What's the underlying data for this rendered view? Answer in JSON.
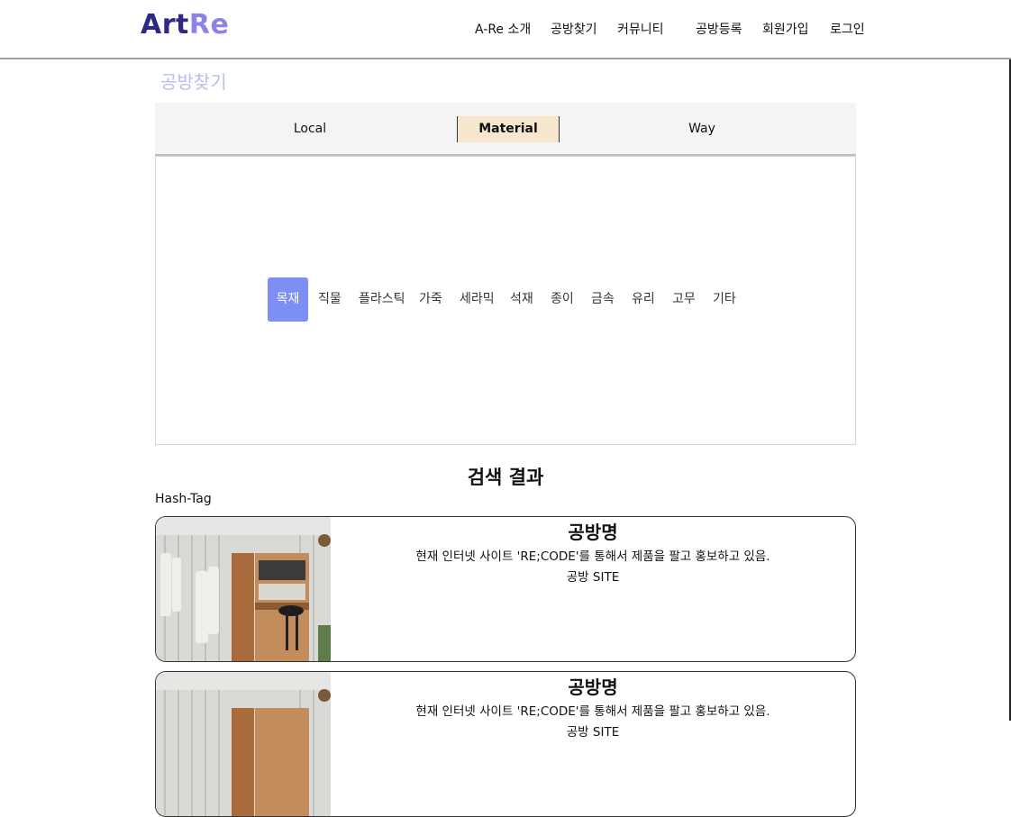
{
  "brand": {
    "part1": "Art",
    "part2": "Re"
  },
  "nav": [
    {
      "label": "A-Re 소개"
    },
    {
      "label": "공방찾기"
    },
    {
      "label": "커뮤니티"
    },
    {
      "label": "공방등록"
    },
    {
      "label": "회원가입"
    },
    {
      "label": "로그인"
    }
  ],
  "page_title": "공방찾기",
  "filter_tabs": [
    {
      "label": "Local",
      "active": false
    },
    {
      "label": "Material",
      "active": true
    },
    {
      "label": "Way",
      "active": false
    }
  ],
  "materials": [
    {
      "label": "목재",
      "selected": true
    },
    {
      "label": "직물"
    },
    {
      "label": "플라스틱"
    },
    {
      "label": "가죽"
    },
    {
      "label": "세라믹"
    },
    {
      "label": "석재"
    },
    {
      "label": "종이"
    },
    {
      "label": "금속"
    },
    {
      "label": "유리"
    },
    {
      "label": "고무"
    },
    {
      "label": "기타"
    }
  ],
  "results": {
    "title": "검색 결과",
    "hashtag_label": "Hash-Tag",
    "cards": [
      {
        "name": "공방명",
        "description": "현재 인터넷 사이트 'RE;CODE'를 통해서 제품을 팔고 홍보하고 있음.",
        "site": "공방 SITE"
      },
      {
        "name": "공방명",
        "description": "현재 인터넷 사이트 'RE;CODE'를 통해서 제품을 팔고 홍보하고 있음.",
        "site": "공방 SITE"
      }
    ]
  },
  "colors": {
    "brand_dark": "#2e2a83",
    "brand_light": "#8a84e6",
    "selected_material": "#7d8ef5",
    "active_tab": "#f7e7cf",
    "page_title": "#b9bef1"
  }
}
